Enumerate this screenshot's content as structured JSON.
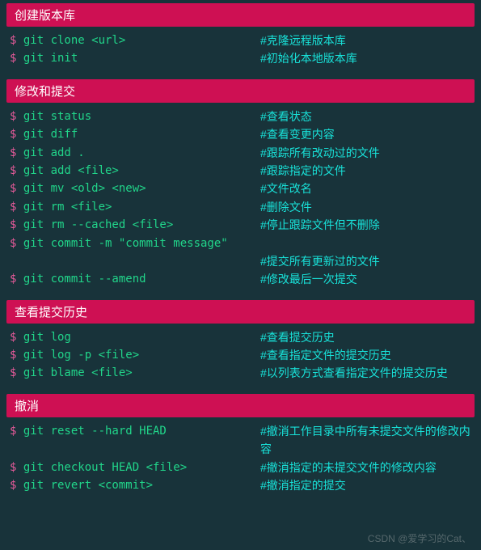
{
  "sections": [
    {
      "title": "创建版本库",
      "rows": [
        {
          "cmd": "git clone <url>",
          "comment": "#克隆远程版本库"
        },
        {
          "cmd": "git init",
          "comment": "#初始化本地版本库"
        }
      ]
    },
    {
      "title": "修改和提交",
      "rows": [
        {
          "cmd": "git status",
          "comment": "#查看状态"
        },
        {
          "cmd": "git diff",
          "comment": "#查看变更内容"
        },
        {
          "cmd": "git add .",
          "comment": "#跟踪所有改动过的文件"
        },
        {
          "cmd": "git add <file>",
          "comment": "#跟踪指定的文件"
        },
        {
          "cmd": "git mv <old> <new>",
          "comment": "#文件改名"
        },
        {
          "cmd": "git rm <file>",
          "comment": "#删除文件"
        },
        {
          "cmd": "git rm --cached <file>",
          "comment": "#停止跟踪文件但不删除"
        },
        {
          "cmd": "git commit -m \"commit message\"",
          "comment": ""
        },
        {
          "cmd": "",
          "comment": "#提交所有更新过的文件"
        },
        {
          "cmd": "git commit --amend",
          "comment": "#修改最后一次提交"
        }
      ]
    },
    {
      "title": "查看提交历史",
      "rows": [
        {
          "cmd": "git log",
          "comment": "#查看提交历史"
        },
        {
          "cmd": "git log -p <file>",
          "comment": "#查看指定文件的提交历史"
        },
        {
          "cmd": "git blame <file>",
          "comment": "#以列表方式查看指定文件的提交历史"
        }
      ]
    },
    {
      "title": "撤消",
      "rows": [
        {
          "cmd": "git reset --hard HEAD",
          "comment": "#撤消工作目录中所有未提交文件的修改内容"
        },
        {
          "cmd": "git checkout HEAD <file>",
          "comment": "#撤消指定的未提交文件的修改内容"
        },
        {
          "cmd": "git revert <commit>",
          "comment": "#撤消指定的提交"
        }
      ]
    }
  ],
  "prompt": "$ ",
  "watermark": "CSDN @爱学习的Cat、"
}
